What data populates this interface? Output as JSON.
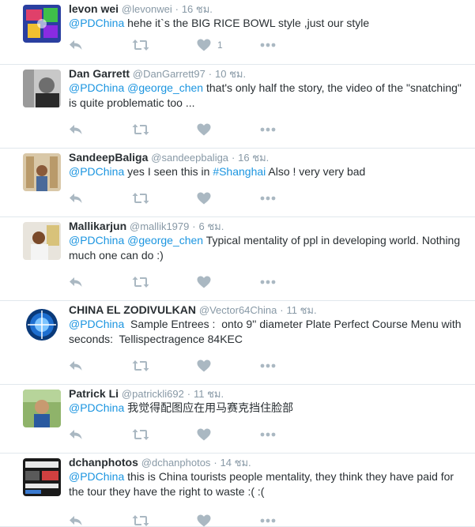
{
  "tweets": [
    {
      "name": "levon wei",
      "handle": "@levonwei",
      "time": "16 ชม.",
      "lines": [
        [
          {
            "t": "@PDChina",
            "k": "mention"
          },
          {
            "t": " hehe it`s the BIG RICE BOWL style ,just our style",
            "k": "text"
          }
        ]
      ],
      "likes": "1"
    },
    {
      "name": "Dan Garrett",
      "handle": "@DanGarrett97",
      "time": "10 ชม.",
      "lines": [
        [
          {
            "t": "@PDChina",
            "k": "mention"
          },
          {
            "t": " ",
            "k": "text"
          },
          {
            "t": "@george_chen",
            "k": "mention"
          },
          {
            "t": " that's only half the story, the video of the \"snatching\"",
            "k": "text"
          }
        ],
        [
          {
            "t": "is quite problematic too ...",
            "k": "text"
          }
        ]
      ],
      "likes": ""
    },
    {
      "name": "SandeepBaliga",
      "handle": "@sandeepbaliga",
      "time": "16 ชม.",
      "lines": [
        [
          {
            "t": "@PDChina",
            "k": "mention"
          },
          {
            "t": " yes I seen this in ",
            "k": "text"
          },
          {
            "t": "#Shanghai",
            "k": "hashtag"
          },
          {
            "t": " Also ! very very bad",
            "k": "text"
          }
        ]
      ],
      "likes": ""
    },
    {
      "name": "Mallikarjun",
      "handle": "@mallik1979",
      "time": "6 ชม.",
      "lines": [
        [
          {
            "t": "@PDChina",
            "k": "mention"
          },
          {
            "t": " ",
            "k": "text"
          },
          {
            "t": "@george_chen",
            "k": "mention"
          },
          {
            "t": " Typical mentality of ppl in developing world. Nothing",
            "k": "text"
          }
        ],
        [
          {
            "t": "much one can do :)",
            "k": "text"
          }
        ]
      ],
      "likes": ""
    },
    {
      "name": "CHINA EL ZODIVULKAN",
      "handle": "@Vector64China",
      "time": "11 ชม.",
      "lines": [
        [
          {
            "t": "@PDChina",
            "k": "mention"
          },
          {
            "t": "  Sample Entrees :  onto 9'' diameter Plate Perfect Course Menu with",
            "k": "text"
          }
        ],
        [
          {
            "t": "seconds:  Tellispectragence 84KEC",
            "k": "text"
          }
        ]
      ],
      "likes": ""
    },
    {
      "name": "Patrick Li",
      "handle": "@patrickli692",
      "time": "11 ชม.",
      "lines": [
        [
          {
            "t": "@PDChina",
            "k": "mention"
          },
          {
            "t": " 我觉得配图应在用马赛克挡住脸部",
            "k": "text"
          }
        ]
      ],
      "likes": ""
    },
    {
      "name": "dchanphotos",
      "handle": "@dchanphotos",
      "time": "14 ชม.",
      "lines": [
        [
          {
            "t": "@PDChina",
            "k": "mention"
          },
          {
            "t": " this is China tourists people mentality, they think they have paid for",
            "k": "text"
          }
        ],
        [
          {
            "t": "the tour they have the right to waste :( :(",
            "k": "text"
          }
        ]
      ],
      "likes": ""
    }
  ],
  "header_separator": "·",
  "colors": {
    "link": "#1b95e0",
    "meta": "#8899a6",
    "icon": "#aab8c2",
    "divider": "#e1e8ed"
  },
  "icons": [
    "reply-icon",
    "retweet-icon",
    "like-icon",
    "more-icon"
  ]
}
